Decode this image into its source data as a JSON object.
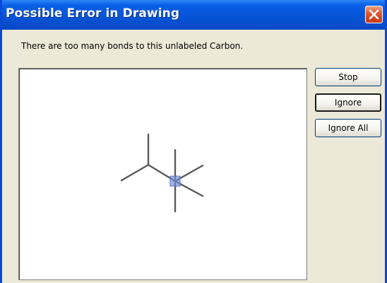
{
  "dialog": {
    "title": "Possible Error in Drawing",
    "message": "There are too many bonds to this unlabeled Carbon."
  },
  "buttons": {
    "stop": "Stop",
    "ignore": "Ignore",
    "ignore_all": "Ignore All"
  },
  "drawing": {
    "bond_color": "#5a5a5a",
    "highlight_color": "#6f8fd8"
  },
  "colors": {
    "titlebar": "#0653d6",
    "close_button": "#e0532b",
    "dialog_background": "#ece9d8"
  }
}
